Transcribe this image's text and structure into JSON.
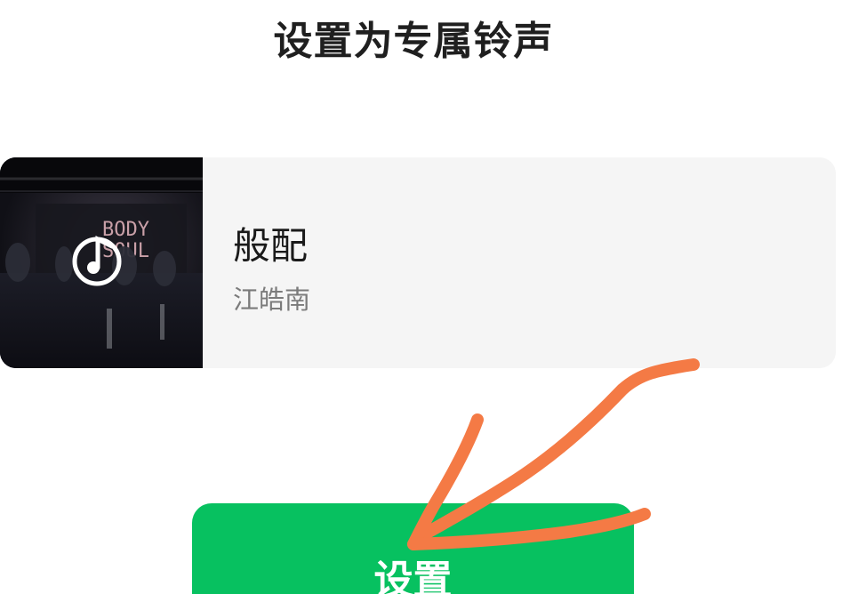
{
  "header": {
    "title": "设置为专属铃声"
  },
  "song": {
    "title": "般配",
    "artist": "江皓南",
    "cover_text_line1": "BODY",
    "cover_text_line2": "SOUL",
    "cover_icon": "music-note-icon"
  },
  "actions": {
    "set_label": "设置"
  },
  "colors": {
    "primary_green": "#07c160",
    "annotation_orange": "#f47a45"
  }
}
